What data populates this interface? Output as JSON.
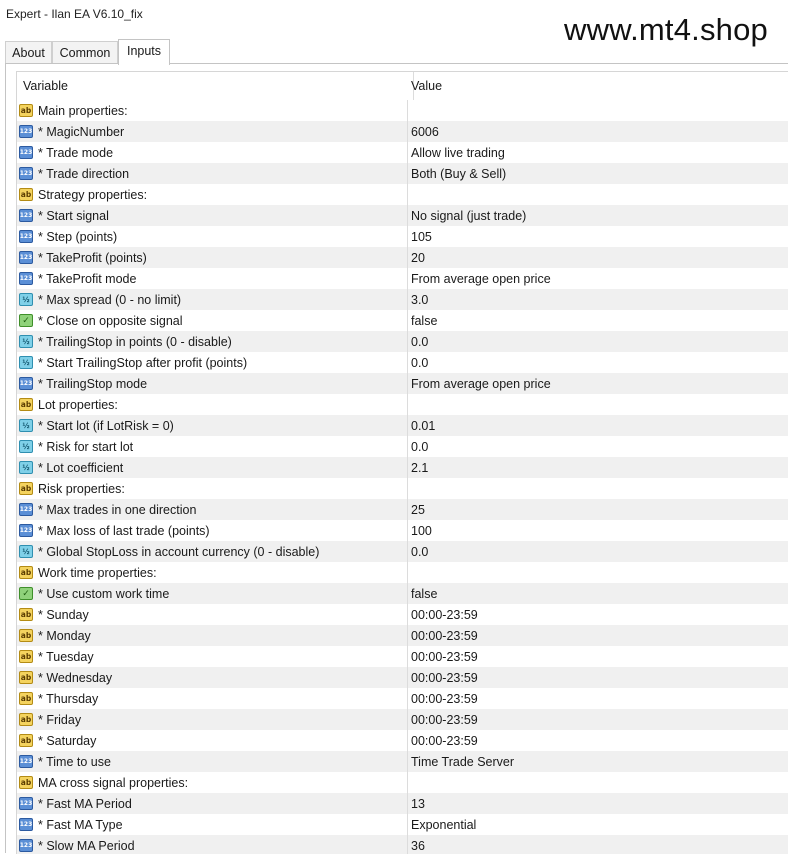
{
  "window": {
    "title": "Expert - Ilan EA V6.10_fix"
  },
  "watermark": "www.mt4.shop",
  "tabs": [
    {
      "label": "About",
      "active": false
    },
    {
      "label": "Common",
      "active": false
    },
    {
      "label": "Inputs",
      "active": true
    }
  ],
  "table": {
    "headers": {
      "variable": "Variable",
      "value": "Value"
    },
    "rows": [
      {
        "type": "group",
        "icon": "string-icon",
        "name": "Main properties:",
        "value": ""
      },
      {
        "type": "param",
        "icon": "integer-icon",
        "name": "* MagicNumber",
        "value": "6006"
      },
      {
        "type": "param",
        "icon": "integer-icon",
        "name": "* Trade mode",
        "value": "Allow live trading"
      },
      {
        "type": "param",
        "icon": "integer-icon",
        "name": "* Trade direction",
        "value": "Both (Buy & Sell)"
      },
      {
        "type": "group",
        "icon": "string-icon",
        "name": "Strategy properties:",
        "value": ""
      },
      {
        "type": "param",
        "icon": "integer-icon",
        "name": "* Start signal",
        "value": "No signal (just trade)"
      },
      {
        "type": "param",
        "icon": "integer-icon",
        "name": "* Step (points)",
        "value": "105"
      },
      {
        "type": "param",
        "icon": "integer-icon",
        "name": "* TakeProfit (points)",
        "value": "20"
      },
      {
        "type": "param",
        "icon": "integer-icon",
        "name": "* TakeProfit mode",
        "value": "From average open price"
      },
      {
        "type": "param",
        "icon": "double-icon",
        "name": "* Max spread (0 - no limit)",
        "value": "3.0"
      },
      {
        "type": "param",
        "icon": "bool-icon",
        "name": "* Close on opposite signal",
        "value": "false"
      },
      {
        "type": "param",
        "icon": "double-icon",
        "name": "* TrailingStop in points (0 - disable)",
        "value": "0.0"
      },
      {
        "type": "param",
        "icon": "double-icon",
        "name": "* Start TrailingStop after profit (points)",
        "value": "0.0"
      },
      {
        "type": "param",
        "icon": "integer-icon",
        "name": "* TrailingStop mode",
        "value": "From average open price"
      },
      {
        "type": "group",
        "icon": "string-icon",
        "name": "Lot properties:",
        "value": ""
      },
      {
        "type": "param",
        "icon": "double-icon",
        "name": "* Start lot (if LotRisk = 0)",
        "value": "0.01"
      },
      {
        "type": "param",
        "icon": "double-icon",
        "name": "* Risk for start lot",
        "value": "0.0"
      },
      {
        "type": "param",
        "icon": "double-icon",
        "name": "* Lot coefficient",
        "value": "2.1"
      },
      {
        "type": "group",
        "icon": "string-icon",
        "name": "Risk properties:",
        "value": ""
      },
      {
        "type": "param",
        "icon": "integer-icon",
        "name": "* Max trades in one direction",
        "value": "25"
      },
      {
        "type": "param",
        "icon": "integer-icon",
        "name": "* Max loss of last trade (points)",
        "value": "100"
      },
      {
        "type": "param",
        "icon": "double-icon",
        "name": "* Global StopLoss in account currency (0 - disable)",
        "value": "0.0"
      },
      {
        "type": "group",
        "icon": "string-icon",
        "name": "Work time properties:",
        "value": ""
      },
      {
        "type": "param",
        "icon": "bool-icon",
        "name": "* Use custom work time",
        "value": "false"
      },
      {
        "type": "param",
        "icon": "string-icon",
        "name": "* Sunday",
        "value": "00:00-23:59"
      },
      {
        "type": "param",
        "icon": "string-icon",
        "name": "* Monday",
        "value": "00:00-23:59"
      },
      {
        "type": "param",
        "icon": "string-icon",
        "name": "* Tuesday",
        "value": "00:00-23:59"
      },
      {
        "type": "param",
        "icon": "string-icon",
        "name": "* Wednesday",
        "value": "00:00-23:59"
      },
      {
        "type": "param",
        "icon": "string-icon",
        "name": "* Thursday",
        "value": "00:00-23:59"
      },
      {
        "type": "param",
        "icon": "string-icon",
        "name": "* Friday",
        "value": "00:00-23:59"
      },
      {
        "type": "param",
        "icon": "string-icon",
        "name": "* Saturday",
        "value": "00:00-23:59"
      },
      {
        "type": "param",
        "icon": "integer-icon",
        "name": "* Time to use",
        "value": "Time Trade Server"
      },
      {
        "type": "group",
        "icon": "string-icon",
        "name": "MA cross signal properties:",
        "value": ""
      },
      {
        "type": "param",
        "icon": "integer-icon",
        "name": "* Fast MA Period",
        "value": "13"
      },
      {
        "type": "param",
        "icon": "integer-icon",
        "name": "* Fast MA Type",
        "value": "Exponential"
      },
      {
        "type": "param",
        "icon": "integer-icon",
        "name": "* Slow MA Period",
        "value": "36"
      }
    ]
  },
  "icon_glyphs": {
    "string-icon": "ab",
    "integer-icon": "123",
    "double-icon": "½",
    "bool-icon": "✓"
  }
}
